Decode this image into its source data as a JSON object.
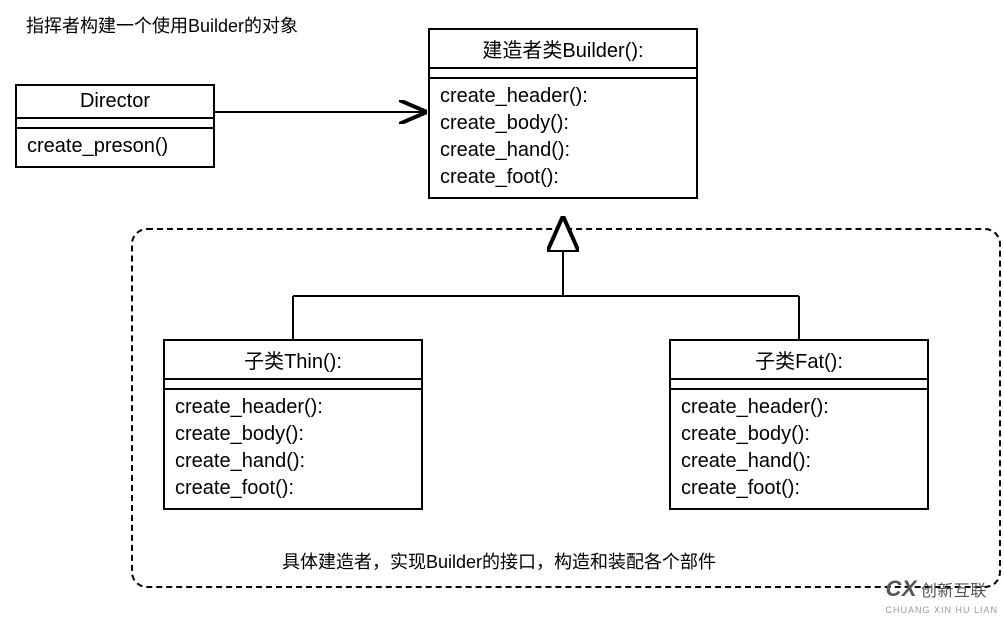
{
  "chart_data": {
    "type": "diagram",
    "description": "UML class diagram — Builder pattern",
    "classes": [
      {
        "id": "director",
        "name": "Director",
        "methods": [
          "create_preson()"
        ]
      },
      {
        "id": "builder",
        "name": "建造者类Builder():",
        "methods": [
          "create_header():",
          "create_body():",
          "create_hand():",
          "create_foot():"
        ]
      },
      {
        "id": "thin",
        "name": "子类Thin():",
        "methods": [
          "create_header():",
          "create_body():",
          "create_hand():",
          "create_foot():"
        ]
      },
      {
        "id": "fat",
        "name": "子类Fat():",
        "methods": [
          "create_header():",
          "create_body():",
          "create_hand():",
          "create_foot():"
        ]
      }
    ],
    "relationships": [
      {
        "from": "director",
        "to": "builder",
        "type": "association"
      },
      {
        "from": "thin",
        "to": "builder",
        "type": "inheritance"
      },
      {
        "from": "fat",
        "to": "builder",
        "type": "inheritance"
      }
    ],
    "notes": [
      "指挥者构建一个使用Builder的对象",
      "具体建造者，实现Builder的接口，构造和装配各个部件"
    ]
  },
  "director": {
    "title": "Director",
    "method1": "create_preson()"
  },
  "builder": {
    "title": "建造者类Builder():",
    "m1": "create_header():",
    "m2": "create_body():",
    "m3": "create_hand():",
    "m4": "create_foot():"
  },
  "thin": {
    "title": "子类Thin():",
    "m1": "create_header():",
    "m2": "create_body():",
    "m3": "create_hand():",
    "m4": "create_foot():"
  },
  "fat": {
    "title": "子类Fat():",
    "m1": "create_header():",
    "m2": "create_body():",
    "m3": "create_hand():",
    "m4": "create_foot():"
  },
  "notes": {
    "top": "指挥者构建一个使用Builder的对象",
    "bottom": "具体建造者，实现Builder的接口，构造和装配各个部件"
  },
  "watermark": {
    "brand_cn": "创新互联",
    "brand_py": "CHUANG XIN HU LIAN",
    "logo": "CX"
  }
}
